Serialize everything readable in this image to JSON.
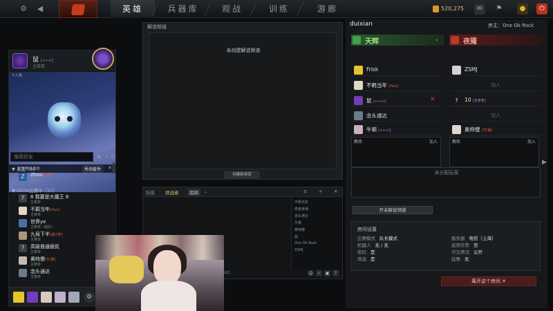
{
  "topbar": {
    "nav_tabs": [
      "英雄",
      "兵器库",
      "观战",
      "训练",
      "游廊"
    ],
    "currency": "520,275",
    "icons": [
      "gear-icon",
      "back-icon",
      "dota-logo",
      "mail-icon",
      "profile-card-icon",
      "notification-icon",
      "power-icon"
    ]
  },
  "left": {
    "profile": {
      "name": "鼠",
      "tag": "[+++/]",
      "status": "主菜单"
    },
    "showcase": {
      "caption": "个人秀",
      "footer_label": "配置秀场套件",
      "edit_button": "秀场套件",
      "close": "✕"
    },
    "search_placeholder": "搜索好友",
    "groups": [
      {
        "label": "▼ 关注（1）"
      },
      {
        "label": "▼ DOTA比赛中（37）"
      }
    ],
    "friends": [
      {
        "name": "Zhou",
        "tag": "[雅林]",
        "status": "主菜单",
        "avatar": "Z"
      },
      {
        "name": "8 我要是大魔王 8",
        "tag": "",
        "status": "主菜单",
        "avatar": "?"
      },
      {
        "name": "不羁当年",
        "tag": "[Hao]",
        "status": "主菜单",
        "avatar": ""
      },
      {
        "name": "世界ye",
        "tag": "",
        "status": "主菜单（组队）",
        "avatar": ""
      },
      {
        "name": "九局下半",
        "tag": "[潮汐梦]",
        "status": "主菜单",
        "avatar": ""
      },
      {
        "name": "高级普通居民",
        "tag": "",
        "status": "主菜单",
        "avatar": "?"
      },
      {
        "name": "奥特傻",
        "tag": "[TC钢]",
        "status": "主菜单",
        "avatar": ""
      },
      {
        "name": "念头通达",
        "tag": "",
        "status": "主菜单",
        "avatar": ""
      }
    ]
  },
  "broadcast": {
    "title": "解说频道",
    "empty_text": "未创建解说频道",
    "new_channel": "创建新频道"
  },
  "chat": {
    "tabs": [
      "队伍",
      "观战者",
      "房间"
    ],
    "members": [
      "不羁当年",
      "高级普通",
      "念头通达",
      "牛顿",
      "奥特傻",
      "鼠",
      "One Ok Rock",
      "ZSMJ"
    ],
    "input_placeholder": "(发送消息..."
  },
  "lobby": {
    "title": "duixian",
    "owner_label": "房主：One Ok Rock",
    "radiant": {
      "name": "天辉",
      "color": "#2e8a3a",
      "slots": [
        {
          "name": "Frisk",
          "tag": "",
          "avatar": ""
        },
        {
          "name": "不羁当年",
          "tag": "[Hao]",
          "avatar": ""
        },
        {
          "name": "鼠",
          "tag": "[+++/]",
          "avatar": ""
        },
        {
          "name": "念头通达",
          "tag": "",
          "avatar": ""
        },
        {
          "name": "牛顿",
          "tag": "[+++/]",
          "avatar": ""
        }
      ],
      "coach": "教练",
      "coach_join": "加入"
    },
    "dire": {
      "name": "夜魇",
      "color": "#8a2424",
      "slots": [
        {
          "name": "ZSMJ",
          "tag": "",
          "avatar": ""
        },
        {
          "name": "",
          "join": "加入",
          "avatar": ""
        },
        {
          "name": "10",
          "tag": "[名誉者]",
          "avatar": "?"
        },
        {
          "name": "",
          "join": "加入",
          "avatar": ""
        },
        {
          "name": "奥特傻",
          "tag": "[TC钢]",
          "avatar": ""
        }
      ],
      "coach": "教练",
      "coach_join": "加入"
    },
    "unassigned_label": "未分配玩家",
    "toggle_broadcast": "开关解说频道",
    "settings": {
      "title": "房间设置",
      "rows": [
        {
          "label": "比赛模式",
          "value": "队长模式"
        },
        {
          "label": "服务器",
          "value": "电信（上海）"
        },
        {
          "label": "机器人",
          "value": "无 / 无"
        },
        {
          "label": "启用作弊",
          "value": "否"
        },
        {
          "label": "密码",
          "value": "是"
        },
        {
          "label": "可见情况",
          "value": "公开"
        },
        {
          "label": "观战",
          "value": "是"
        },
        {
          "label": "延赛",
          "value": "无"
        }
      ]
    },
    "leave_button": "离开这个房间 ✕"
  }
}
